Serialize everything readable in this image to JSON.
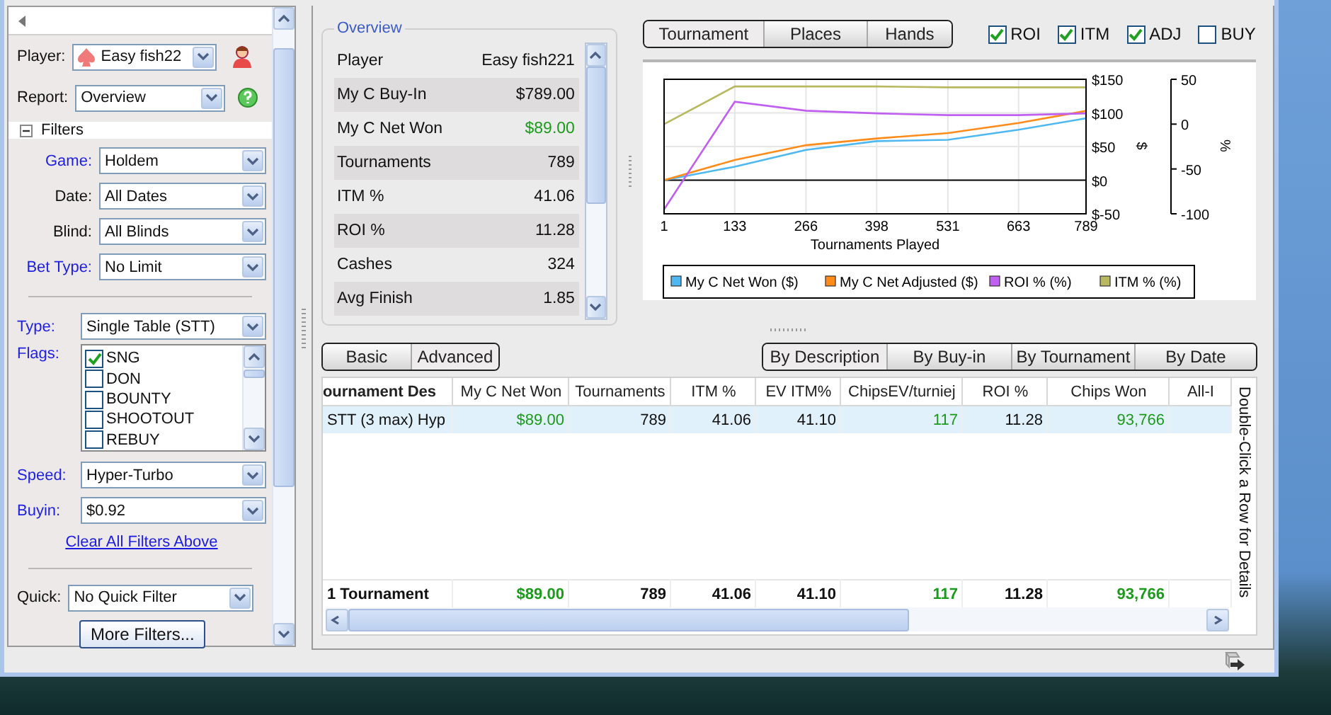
{
  "sidebar": {
    "player": {
      "label": "Player:",
      "value": "Easy fish22"
    },
    "report": {
      "label": "Report:",
      "value": "Overview"
    },
    "filters_header": {
      "label": "Filters",
      "expanded": true
    },
    "basic_filters": [
      {
        "label": "Game:",
        "value": "Holdem",
        "active": true
      },
      {
        "label": "Date:",
        "value": "All Dates",
        "active": false
      },
      {
        "label": "Blind:",
        "value": "All Blinds",
        "active": false
      },
      {
        "label": "Bet Type:",
        "value": "No Limit",
        "active": true
      }
    ],
    "tournament_filters": [
      {
        "kind": "combo",
        "label": "Type:",
        "value": "Single Table (STT)",
        "active": true
      },
      {
        "kind": "flags",
        "label": "Flags:",
        "active": true,
        "items": [
          {
            "label": "SNG",
            "checked": true
          },
          {
            "label": "DON",
            "checked": false
          },
          {
            "label": "BOUNTY",
            "checked": false
          },
          {
            "label": "SHOOTOUT",
            "checked": false
          },
          {
            "label": "REBUY",
            "checked": false
          }
        ]
      },
      {
        "kind": "combo",
        "label": "Speed:",
        "value": "Hyper-Turbo",
        "active": true
      },
      {
        "kind": "combo",
        "label": "Buyin:",
        "value": "$0.92",
        "active": true
      }
    ],
    "clear_link": "Clear All Filters Above",
    "quick": {
      "label": "Quick:",
      "value": "No Quick Filter"
    },
    "more_button": "More Filters..."
  },
  "overview": {
    "title": "Overview",
    "rows": [
      {
        "label": "Player",
        "value": "Easy fish221",
        "positive": false
      },
      {
        "label": "My C Buy-In",
        "value": "$789.00",
        "positive": false
      },
      {
        "label": "My C Net Won",
        "value": "$89.00",
        "positive": true
      },
      {
        "label": "Tournaments",
        "value": "789",
        "positive": false
      },
      {
        "label": "ITM %",
        "value": "41.06",
        "positive": false
      },
      {
        "label": "ROI %",
        "value": "11.28",
        "positive": false
      },
      {
        "label": "Cashes",
        "value": "324",
        "positive": false
      },
      {
        "label": "Avg Finish",
        "value": "1.85",
        "positive": false
      }
    ]
  },
  "chart_tabs": [
    {
      "label": "Tournament",
      "selected": true
    },
    {
      "label": "Places",
      "selected": false
    },
    {
      "label": "Hands",
      "selected": false
    }
  ],
  "chart_toggles": [
    {
      "label": "ROI",
      "checked": true
    },
    {
      "label": "ITM",
      "checked": true
    },
    {
      "label": "ADJ",
      "checked": true
    },
    {
      "label": "BUY",
      "checked": false
    }
  ],
  "chart": {
    "chart_data": {
      "type": "line",
      "grid": true,
      "legend": true,
      "xlabel": "Tournaments Played",
      "ylabel": "$",
      "y2label": "%",
      "x": [
        1,
        133,
        266,
        398,
        531,
        663,
        789
      ],
      "xlim": [
        1,
        789
      ],
      "xticks": [
        1,
        133,
        266,
        398,
        531,
        663,
        789
      ],
      "ylim": [
        -50,
        150
      ],
      "yticks": [
        {
          "value": 150,
          "label": "$150"
        },
        {
          "value": 100,
          "label": "$100"
        },
        {
          "value": 50,
          "label": "$50"
        },
        {
          "value": 0,
          "label": "$0"
        },
        {
          "value": -50,
          "label": "$-50"
        }
      ],
      "y2lim": [
        -100,
        50
      ],
      "y2ticks": [
        50,
        0,
        -50,
        -100
      ],
      "series": [
        {
          "name": "My C Net Won ($)",
          "color": "#4fb8f0",
          "values": [
            0,
            20,
            45,
            58,
            60,
            75,
            92
          ]
        },
        {
          "name": "My C Net Adjusted ($)",
          "color": "#ff8c1a",
          "values": [
            0,
            30,
            52,
            62,
            70,
            85,
            103
          ]
        },
        {
          "name": "ROI % (%)",
          "color": "#c060f0",
          "axis": "y2",
          "values": [
            -95,
            25,
            15,
            12,
            10,
            10,
            12
          ]
        },
        {
          "name": "ITM % (%)",
          "color": "#b8b860",
          "axis": "y2",
          "values": [
            0,
            42,
            42,
            42,
            41,
            41,
            41
          ]
        }
      ]
    }
  },
  "view_tabs": [
    {
      "label": "Basic",
      "selected": false
    },
    {
      "label": "Advanced",
      "selected": true
    }
  ],
  "group_tabs": [
    {
      "label": "By Description",
      "selected": true
    },
    {
      "label": "By Buy-in",
      "selected": false
    },
    {
      "label": "By Tournament",
      "selected": false
    },
    {
      "label": "By Date",
      "selected": false
    }
  ],
  "table": {
    "columns": [
      "ournament Des",
      "My C Net Won",
      "Tournaments",
      "ITM %",
      "EV ITM%",
      "ChipsEV/turniej",
      "ROI %",
      "Chips Won",
      "All-I"
    ],
    "rows": [
      {
        "kind": "data",
        "selected": true,
        "cells": [
          {
            "text": "STT (3 max) Hyp",
            "positive": false
          },
          {
            "text": "$89.00",
            "positive": true
          },
          {
            "text": "789",
            "positive": false
          },
          {
            "text": "41.06",
            "positive": false
          },
          {
            "text": "41.10",
            "positive": false
          },
          {
            "text": "117",
            "positive": true
          },
          {
            "text": "11.28",
            "positive": false
          },
          {
            "text": "93,766",
            "positive": true
          }
        ]
      },
      {
        "kind": "total",
        "selected": false,
        "cells": [
          {
            "text": "1 Tournament",
            "positive": false
          },
          {
            "text": "$89.00",
            "positive": true
          },
          {
            "text": "789",
            "positive": false
          },
          {
            "text": "41.06",
            "positive": false
          },
          {
            "text": "41.10",
            "positive": false
          },
          {
            "text": "117",
            "positive": true
          },
          {
            "text": "11.28",
            "positive": false
          },
          {
            "text": "93,766",
            "positive": true
          }
        ]
      }
    ],
    "hint": "Double-Click a Row for Details"
  }
}
